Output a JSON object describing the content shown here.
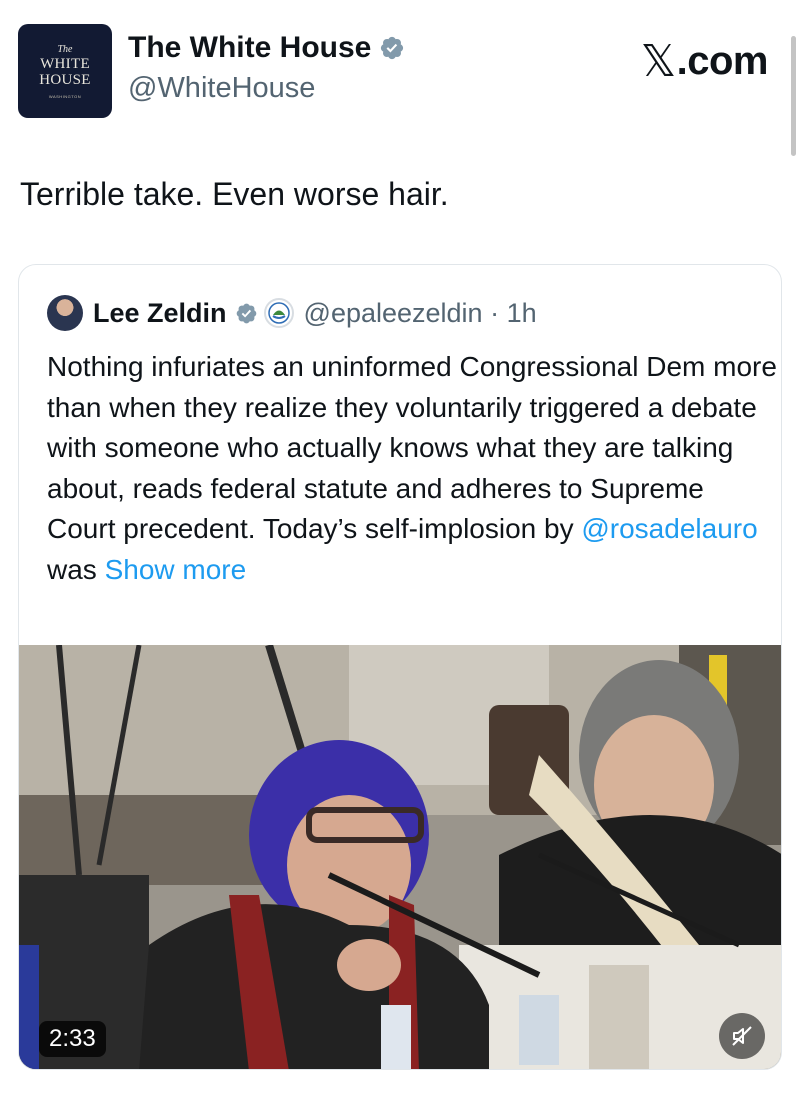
{
  "post": {
    "author_name": "The White House",
    "author_handle": "@WhiteHouse",
    "avatar_text": {
      "the": "The",
      "white": "WHITE",
      "house": "HOUSE",
      "place": "WASHINGTON"
    },
    "text": "Terrible take. Even worse hair."
  },
  "watermark": {
    "mark": "𝕏",
    "label": ".com"
  },
  "quote": {
    "author_name": "Lee Zeldin",
    "author_handle": "@epaleezeldin",
    "separator": "·",
    "time": "1h",
    "body": "Nothing infuriates an uninformed Congressional Dem more than when they realize they voluntarily triggered a debate with someone who actually knows what they are talking about, reads federal statute and adheres to Supreme Court precedent. Today’s self-implosion by",
    "mention": "@rosadelauro",
    "body_tail": "was",
    "show_more": "Show more",
    "video": {
      "duration": "2:33"
    }
  },
  "colors": {
    "link": "#1d9bf0",
    "verified": "#829aab",
    "muted_text": "#536471"
  },
  "icons": [
    "verified-badge-icon",
    "epa-logo-icon",
    "mute-icon"
  ]
}
